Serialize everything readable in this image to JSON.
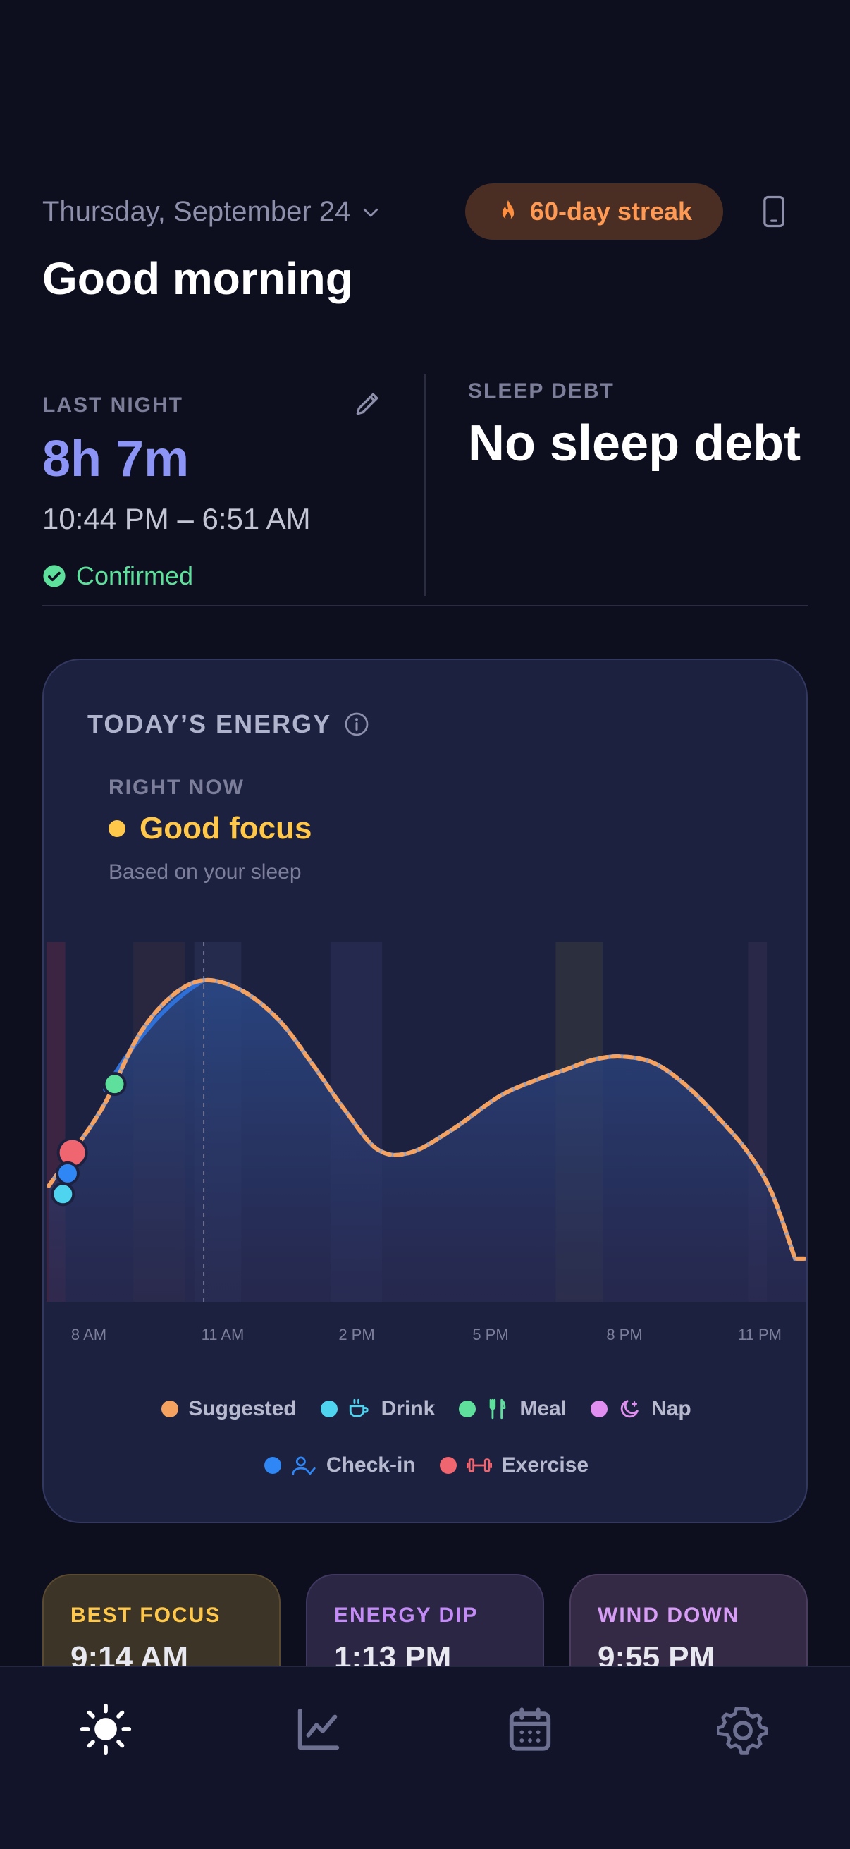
{
  "header": {
    "date": "Thursday, September 24",
    "streak": "60-day streak",
    "greeting": "Good morning"
  },
  "sleep": {
    "last_night_label": "LAST NIGHT",
    "duration": "8h 7m",
    "times": "10:44 PM – 6:51 AM",
    "status": "Confirmed",
    "debt_label": "SLEEP DEBT",
    "debt_value": "No sleep debt"
  },
  "energy": {
    "title": "TODAY’S ENERGY",
    "right_now_label": "RIGHT NOW",
    "state": "Good focus",
    "subtitle": "Based on your sleep",
    "x_labels": [
      "8 AM",
      "11 AM",
      "2 PM",
      "5 PM",
      "8 PM",
      "11 PM"
    ],
    "legend": [
      {
        "label": "Suggested",
        "color": "#f5a261",
        "icon": ""
      },
      {
        "label": "Drink",
        "color": "#4ed4ef",
        "icon": "cup-icon"
      },
      {
        "label": "Meal",
        "color": "#5ee09c",
        "icon": "fork-knife-icon"
      },
      {
        "label": "Nap",
        "color": "#e08ef0",
        "icon": "moon-sparkle-icon"
      },
      {
        "label": "Check-in",
        "color": "#2f86f5",
        "icon": "person-check-icon"
      },
      {
        "label": "Exercise",
        "color": "#f06670",
        "icon": "dumbbell-icon"
      }
    ]
  },
  "chart_data": {
    "type": "line",
    "xlabel": "",
    "ylabel": "",
    "x_ticks": [
      "8 AM",
      "11 AM",
      "2 PM",
      "5 PM",
      "8 PM",
      "11 PM"
    ],
    "series": [
      {
        "name": "Suggested",
        "color": "#f5a261",
        "x": [
          7.4,
          8.0,
          8.6,
          9.3,
          10.0,
          10.7,
          11.5,
          12.3,
          13.0,
          13.7,
          14.4,
          15.1,
          16.0,
          17.0,
          17.8,
          18.4,
          19.0,
          19.6,
          20.3,
          21.0,
          21.7,
          22.3,
          22.8,
          23.3
        ],
        "values": [
          0.35,
          0.47,
          0.6,
          0.8,
          0.92,
          0.97,
          0.94,
          0.85,
          0.72,
          0.58,
          0.46,
          0.45,
          0.52,
          0.62,
          0.67,
          0.7,
          0.73,
          0.74,
          0.72,
          0.65,
          0.55,
          0.45,
          0.33,
          0.13
        ]
      }
    ],
    "markers": [
      {
        "type": "Drink",
        "x": 7.7
      },
      {
        "type": "Check-in",
        "x": 7.8
      },
      {
        "type": "Exercise",
        "x": 7.9
      },
      {
        "type": "Meal",
        "x": 8.8
      }
    ],
    "now": "11 AM"
  },
  "cards": [
    {
      "label": "BEST FOCUS",
      "value": "9:14 AM",
      "color": "#ffc84a",
      "bg": "#3c3426"
    },
    {
      "label": "ENERGY DIP",
      "value": "1:13 PM",
      "color": "#c28bf5",
      "bg": "#2c2645"
    },
    {
      "label": "WIND DOWN",
      "value": "9:55 PM",
      "color": "#d79cf5",
      "bg": "#352a45"
    }
  ],
  "nav": [
    "sun-icon",
    "chart-line-icon",
    "calendar-icon",
    "gear-icon"
  ]
}
